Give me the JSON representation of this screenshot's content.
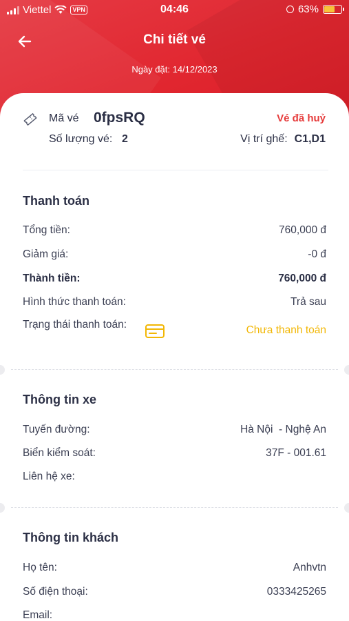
{
  "status_bar": {
    "carrier": "Viettel",
    "vpn": "VPN",
    "time": "04:46",
    "battery": "63%",
    "battery_level": 0.63,
    "battery_color": "#f7c23a"
  },
  "header": {
    "title": "Chi tiết vé",
    "booking_date": "Ngày đặt: 14/12/2023",
    "back_icon": "arrow-left-icon"
  },
  "ticket": {
    "code_label": "Mã vé",
    "code": "0fpsRQ",
    "status": "Vé đã huỷ",
    "quantity_label": "Số lượng vé:",
    "quantity": "2",
    "seat_label": "Vị trí ghế:",
    "seat": "C1,D1",
    "icon": "ticket-icon"
  },
  "payment": {
    "title": "Thanh toán",
    "total_label": "Tổng tiền:",
    "total": "760,000 đ",
    "discount_label": "Giảm giá:",
    "discount": "-0 đ",
    "final_label": "Thành tiền:",
    "final": "760,000 đ",
    "method_label": "Hình thức thanh toán:",
    "method": "Trả sau",
    "status_label": "Trạng thái thanh toán:",
    "status": "Chưa thanh toán",
    "status_icon": "credit-card-icon"
  },
  "vehicle": {
    "title": "Thông tin xe",
    "route_label": "Tuyến đường:",
    "route": "Hà Nội  - Nghệ An",
    "plate_label": "Biển kiểm soát:",
    "plate": "37F - 001.61",
    "contact_label": "Liên hệ xe:",
    "contact": ""
  },
  "customer": {
    "title": "Thông tin khách",
    "name_label": "Họ tên:",
    "name": "Anhvtn",
    "phone_label": "Số điện thoại:",
    "phone": "0333425265",
    "email_label": "Email:",
    "email": ""
  },
  "colors": {
    "header_red": "#e1262f",
    "cancelled_red": "#e63b3b",
    "unpaid_yellow": "#f2b705"
  }
}
